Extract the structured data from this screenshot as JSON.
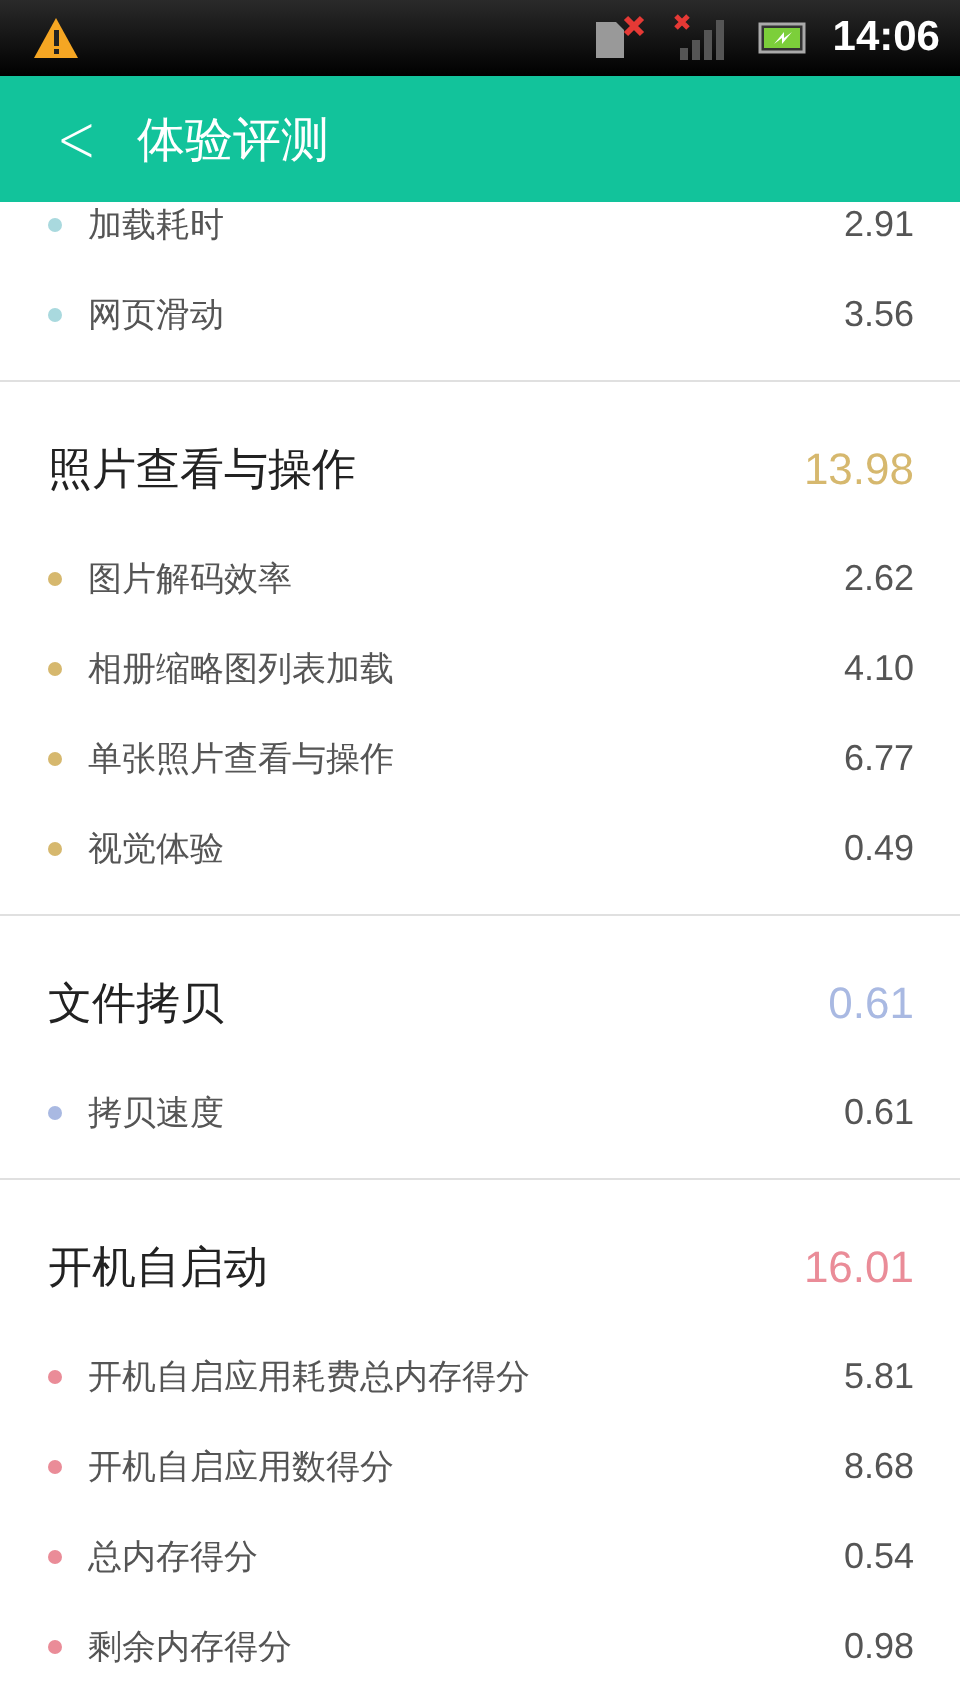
{
  "status_bar": {
    "time": "14:06"
  },
  "header": {
    "back": "<",
    "title": "体验评测"
  },
  "sections": [
    {
      "color": "#a9d9de",
      "items": [
        {
          "label": "加载耗时",
          "value": "2.91"
        },
        {
          "label": "网页滑动",
          "value": "3.56"
        }
      ]
    },
    {
      "title": "照片查看与操作",
      "score": "13.98",
      "color": "#d6b86e",
      "items": [
        {
          "label": "图片解码效率",
          "value": "2.62"
        },
        {
          "label": "相册缩略图列表加载",
          "value": "4.10"
        },
        {
          "label": "单张照片查看与操作",
          "value": "6.77"
        },
        {
          "label": "视觉体验",
          "value": "0.49"
        }
      ]
    },
    {
      "title": "文件拷贝",
      "score": "0.61",
      "color": "#a9b9e2",
      "items": [
        {
          "label": "拷贝速度",
          "value": "0.61"
        }
      ]
    },
    {
      "title": "开机自启动",
      "score": "16.01",
      "color": "#ea8c98",
      "items": [
        {
          "label": "开机自启应用耗费总内存得分",
          "value": "5.81"
        },
        {
          "label": "开机自启应用数得分",
          "value": "8.68"
        },
        {
          "label": "总内存得分",
          "value": "0.54"
        },
        {
          "label": "剩余内存得分",
          "value": "0.98"
        }
      ]
    }
  ]
}
